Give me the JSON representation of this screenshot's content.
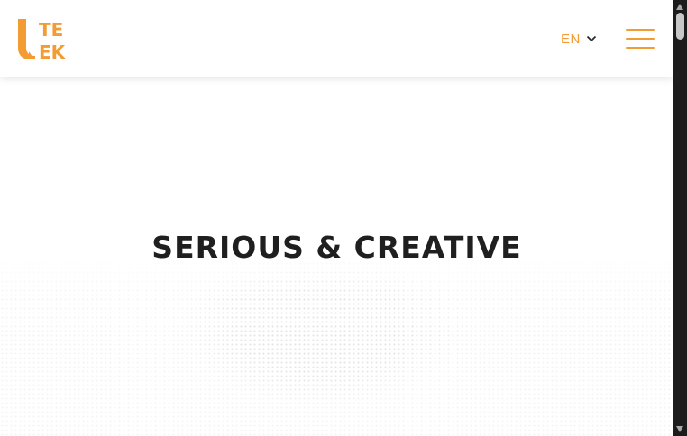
{
  "colors": {
    "accent": "#f39c33",
    "title": "#1f1f1f",
    "scrollbar": "#1c1c1c"
  },
  "header": {
    "logo": {
      "line1": "TE",
      "line2": "EK",
      "icon": "uteek-logo-icon"
    },
    "language": {
      "label": "EN",
      "icon": "chevron-down-icon"
    },
    "menu": {
      "icon": "hamburger-menu-icon"
    }
  },
  "hero": {
    "title": "SERIOUS & CREATIVE"
  },
  "scrollbar": {
    "up_icon": "arrow-up-icon",
    "down_icon": "arrow-down-icon"
  }
}
